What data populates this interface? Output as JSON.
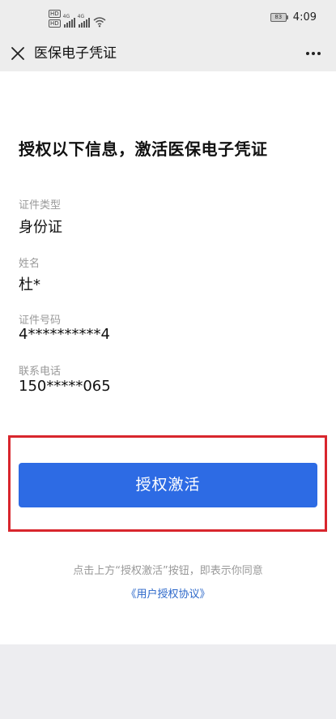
{
  "status_bar": {
    "hd1": "HD",
    "hd2": "HD",
    "net1": "4G",
    "net2": "4G",
    "battery": "83",
    "time": "4:09"
  },
  "nav": {
    "title": "医保电子凭证",
    "close_icon": "close-icon",
    "more_icon": "more-icon"
  },
  "headline": "授权以下信息，激活医保电子凭证",
  "fields": [
    {
      "label": "证件类型",
      "value": "身份证"
    },
    {
      "label": "姓名",
      "value": "杜*"
    },
    {
      "label": "证件号码",
      "value": "4**********4"
    },
    {
      "label": "联系电话",
      "value": "150*****065"
    }
  ],
  "activate_button": "授权激活",
  "consent_text": "点击上方“授权激活”按钮，即表示你同意",
  "agreement_link": "《用户授权协议》",
  "colors": {
    "primary_button": "#2d6be4",
    "highlight_border": "#d8262d",
    "link": "#2b67c9"
  }
}
